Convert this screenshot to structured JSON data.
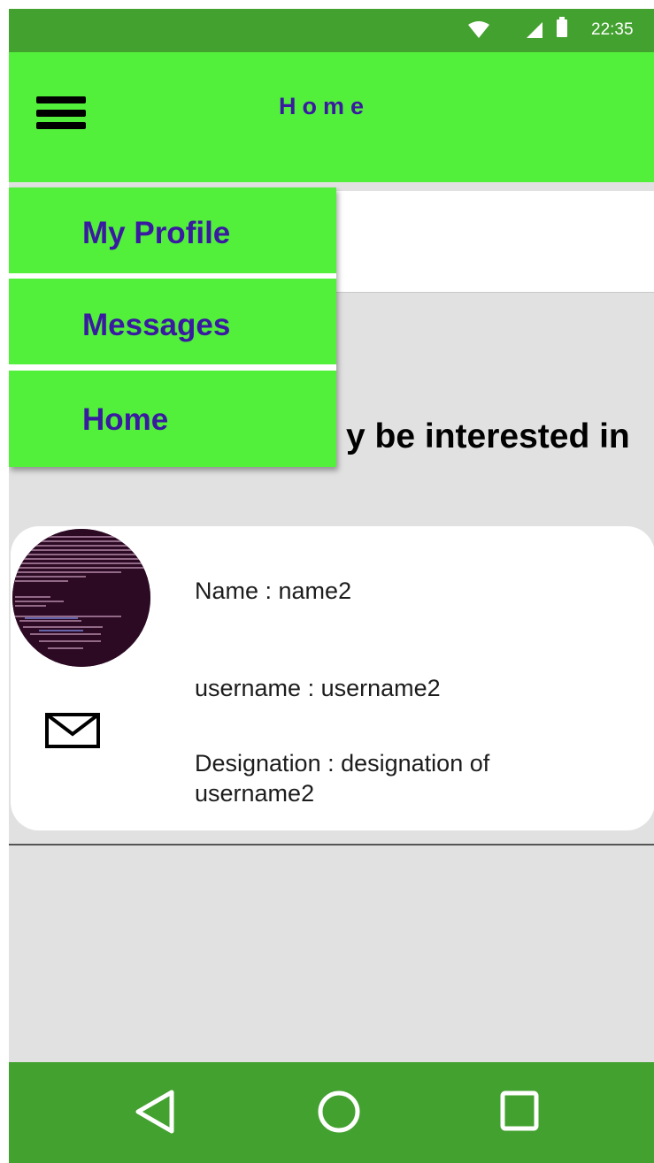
{
  "status_bar": {
    "time": "22:35",
    "icons": [
      "wifi-icon",
      "cell-signal-icon",
      "battery-icon"
    ]
  },
  "app_bar": {
    "menu_icon": "hamburger-menu-icon",
    "title": "Home"
  },
  "drawer": {
    "items": [
      {
        "label": "My Profile"
      },
      {
        "label": "Messages"
      },
      {
        "label": "Home"
      }
    ]
  },
  "main": {
    "heading": "People you may be interested in",
    "heading_visible": "y be interested in"
  },
  "card": {
    "avatar": "terminal-screenshot-avatar",
    "name_line": "Name : name2",
    "username_line": "username : username2",
    "designation_line": "Designation : designation of username2",
    "message_icon": "mail-icon"
  },
  "nav_bar": {
    "icons": [
      "back-icon",
      "home-icon",
      "recents-icon"
    ]
  },
  "colors": {
    "status_bar": "#43a12f",
    "app_bar": "#52ef3b",
    "accent_text": "#3a1aa0",
    "background": "#e1e1e1",
    "nav_bar": "#43a12f"
  }
}
